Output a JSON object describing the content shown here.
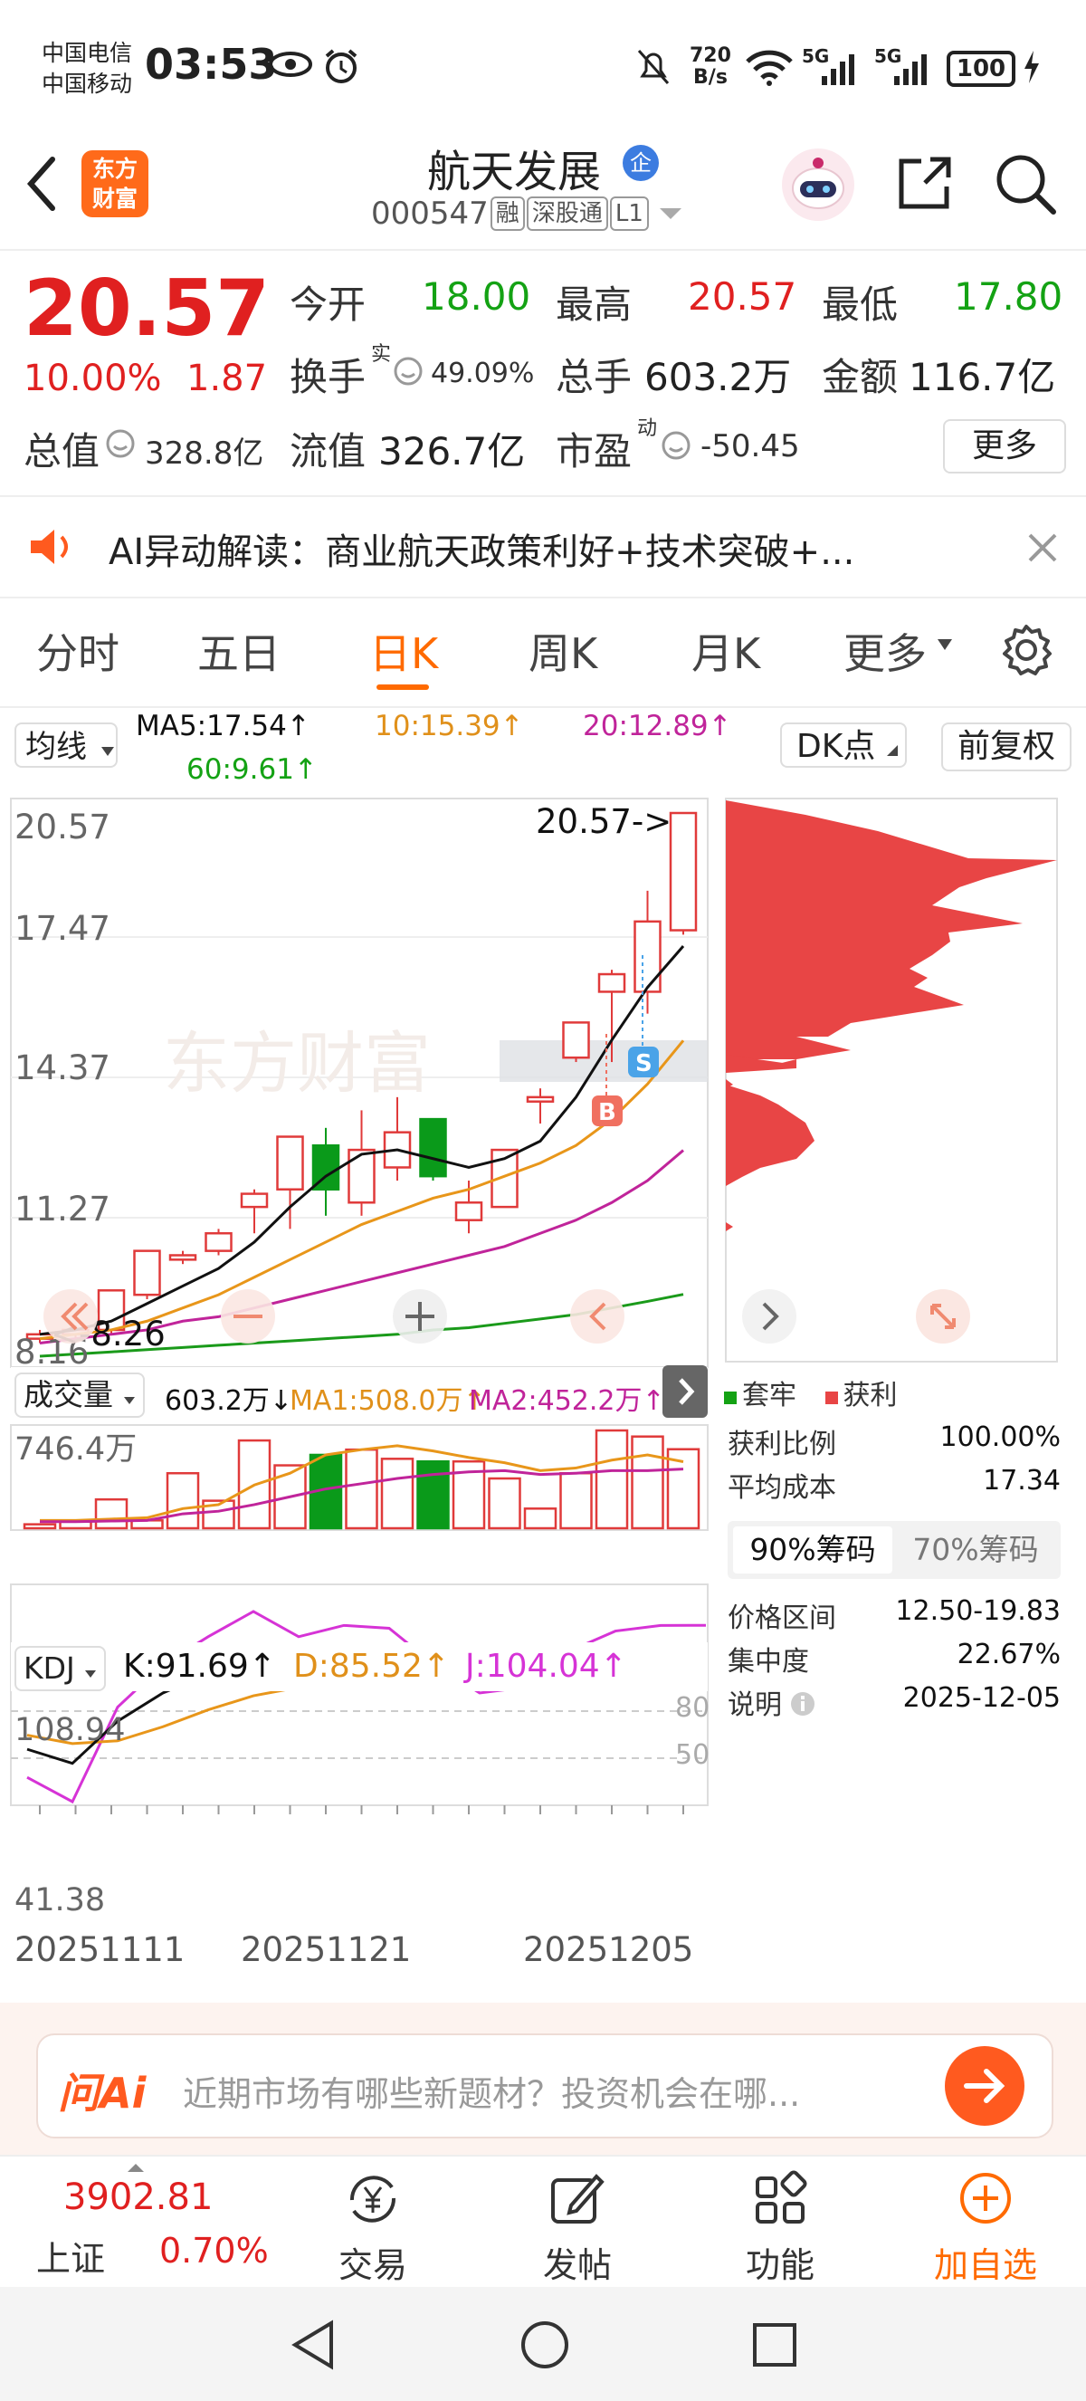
{
  "status_bar": {
    "carrier1": "中国电信",
    "carrier2": "中国移动",
    "time": "03:53",
    "net_speed_top": "720",
    "net_speed_bottom": "B/s",
    "signal1": "5G",
    "signal2": "5G",
    "battery": "100"
  },
  "header": {
    "logo_line1": "东方",
    "logo_line2": "财富",
    "title": "航天发展",
    "title_badge": "企",
    "code": "000547",
    "tags": [
      "融",
      "深股通",
      "L1"
    ]
  },
  "quote": {
    "price": "20.57",
    "change_pct": "10.00%",
    "change_amt": "1.87",
    "open_label": "今开",
    "open_value": "18.00",
    "high_label": "最高",
    "high_value": "20.57",
    "low_label": "最低",
    "low_value": "17.80",
    "turnover_label": "换手",
    "turnover_sup": "实",
    "turnover_value": "49.09%",
    "volume_label": "总手",
    "volume_value": "603.2万",
    "amount_label": "金额",
    "amount_value": "116.7亿",
    "mktcap_label": "总值",
    "mktcap_value": "328.8亿",
    "float_label": "流值",
    "float_value": "326.7亿",
    "pe_label": "市盈",
    "pe_sup": "动",
    "pe_value": "-50.45",
    "more_button": "更多"
  },
  "ai_banner": {
    "text": "AI异动解读：商业航天政策利好+技术突破+..."
  },
  "tabs": {
    "items": [
      "分时",
      "五日",
      "日K",
      "周K",
      "月K",
      "更多"
    ],
    "active_index": 2
  },
  "indicators": {
    "ma_selector": "均线",
    "ma5": "MA5:17.54↑",
    "ma10": "10:15.39↑",
    "ma20": "20:12.89↑",
    "ma60": "60:9.61↑",
    "dk_button": "DK点",
    "adjust_button": "前复权"
  },
  "main_chart": {
    "y_labels": [
      "20.57",
      "17.47",
      "14.37",
      "11.27",
      "8.16"
    ],
    "last_price_marker": "20.57->",
    "low_marker": "<-8.26",
    "watermark": "东方财富",
    "sell_badge": "S",
    "buy_badge": "B"
  },
  "chart_data": {
    "type": "candlestick",
    "candles": [
      {
        "o": 8.6,
        "c": 8.7,
        "h": 8.8,
        "l": 8.5,
        "up": true
      },
      {
        "o": 8.7,
        "c": 8.8,
        "h": 8.9,
        "l": 8.6,
        "up": true
      },
      {
        "o": 8.8,
        "c": 9.7,
        "h": 9.7,
        "l": 8.7,
        "up": true
      },
      {
        "o": 9.6,
        "c": 10.6,
        "h": 10.6,
        "l": 9.5,
        "up": true
      },
      {
        "o": 10.4,
        "c": 10.5,
        "h": 10.6,
        "l": 10.3,
        "up": true
      },
      {
        "o": 10.6,
        "c": 11.0,
        "h": 11.1,
        "l": 10.5,
        "up": true
      },
      {
        "o": 11.6,
        "c": 11.9,
        "h": 12.0,
        "l": 11.0,
        "up": true
      },
      {
        "o": 12.0,
        "c": 13.2,
        "h": 13.2,
        "l": 11.1,
        "up": true
      },
      {
        "o": 13.0,
        "c": 12.0,
        "h": 13.4,
        "l": 11.4,
        "up": false
      },
      {
        "o": 11.7,
        "c": 12.9,
        "h": 13.8,
        "l": 11.4,
        "up": true
      },
      {
        "o": 12.5,
        "c": 13.3,
        "h": 14.1,
        "l": 12.2,
        "up": true
      },
      {
        "o": 13.6,
        "c": 12.3,
        "h": 13.6,
        "l": 12.2,
        "up": false
      },
      {
        "o": 11.3,
        "c": 11.7,
        "h": 12.2,
        "l": 11.0,
        "up": true
      },
      {
        "o": 11.6,
        "c": 12.9,
        "h": 12.9,
        "l": 11.6,
        "up": true
      },
      {
        "o": 14.0,
        "c": 14.1,
        "h": 14.3,
        "l": 13.5,
        "up": true
      },
      {
        "o": 15.0,
        "c": 15.8,
        "h": 15.8,
        "l": 14.9,
        "up": true
      },
      {
        "o": 16.5,
        "c": 16.9,
        "h": 17.0,
        "l": 14.9,
        "up": true
      },
      {
        "o": 16.5,
        "c": 18.1,
        "h": 18.8,
        "l": 16.0,
        "up": true
      },
      {
        "o": 17.9,
        "c": 20.57,
        "h": 20.57,
        "l": 17.8,
        "up": true
      }
    ],
    "ma5": [
      8.7,
      8.8,
      9.0,
      9.4,
      9.8,
      10.2,
      10.8,
      11.6,
      12.3,
      12.8,
      12.9,
      12.7,
      12.5,
      12.7,
      13.1,
      14.1,
      15.4,
      16.6,
      17.54
    ],
    "ma10": [
      8.6,
      8.7,
      8.8,
      9.0,
      9.3,
      9.6,
      10.0,
      10.4,
      10.8,
      11.2,
      11.5,
      11.8,
      12.0,
      12.3,
      12.6,
      13.0,
      13.6,
      14.4,
      15.39
    ],
    "ma20": [
      8.5,
      8.6,
      8.7,
      8.8,
      9.0,
      9.1,
      9.3,
      9.5,
      9.7,
      9.9,
      10.1,
      10.3,
      10.5,
      10.7,
      11.0,
      11.3,
      11.7,
      12.2,
      12.89
    ],
    "ma60": [
      8.2,
      8.25,
      8.3,
      8.35,
      8.4,
      8.45,
      8.5,
      8.55,
      8.6,
      8.65,
      8.7,
      8.8,
      8.85,
      8.95,
      9.05,
      9.15,
      9.3,
      9.45,
      9.61
    ],
    "volume_wan": [
      30,
      50,
      220,
      60,
      420,
      210,
      670,
      480,
      560,
      600,
      530,
      510,
      510,
      380,
      150,
      420,
      746.4,
      700,
      603.2
    ],
    "volume_ma1": [
      60,
      60,
      70,
      80,
      150,
      180,
      330,
      420,
      560,
      600,
      630,
      590,
      540,
      500,
      440,
      460,
      520,
      560,
      508.0
    ],
    "volume_ma2": [
      50,
      50,
      55,
      60,
      110,
      130,
      180,
      240,
      300,
      340,
      380,
      410,
      430,
      440,
      410,
      420,
      440,
      440,
      452.2
    ],
    "kdj_k": [
      60,
      55,
      70,
      80,
      87,
      92,
      90,
      93,
      93,
      88,
      85,
      84,
      84,
      88,
      91,
      91.69
    ],
    "kdj_d": [
      65,
      62,
      63,
      68,
      74,
      79,
      82,
      84,
      84,
      84,
      84,
      84,
      83,
      84,
      85,
      85.52
    ],
    "kdj_j": [
      50,
      41.38,
      75,
      90,
      100,
      108.94,
      100,
      104,
      103,
      90,
      80,
      82,
      95,
      102,
      104,
      104.04
    ]
  },
  "volume_panel": {
    "selector": "成交量",
    "vol": "603.2万↓",
    "ma1": "MA1:508.0万↑",
    "ma2": "MA2:452.2万↑",
    "y_label": "746.4万"
  },
  "kdj_panel": {
    "selector": "KDJ",
    "k": "K:91.69↑",
    "d": "D:85.52↑",
    "j": "J:104.04↑",
    "y_top": "108.94",
    "y_bottom": "41.38",
    "level_80": "80",
    "level_50": "50"
  },
  "x_labels": [
    "20251111",
    "20251121",
    "20251205"
  ],
  "chip_panel": {
    "legend_trapped": "套牢",
    "legend_profit": "获利",
    "rows": [
      {
        "label": "获利比例",
        "value": "100.00%"
      },
      {
        "label": "平均成本",
        "value": "17.34"
      }
    ],
    "tab_90": "90%筹码",
    "tab_70": "70%筹码",
    "rows2": [
      {
        "label": "价格区间",
        "value": "12.50-19.83"
      },
      {
        "label": "集中度",
        "value": "22.67%"
      },
      {
        "label": "说明",
        "value": "2025-12-05"
      }
    ]
  },
  "ai_search": {
    "logo": "问Ai",
    "placeholder": "近期市场有哪些新题材？投资机会在哪..."
  },
  "bottom_nav": {
    "index_value": "3902.81",
    "index_name": "上证",
    "index_change": "0.70%",
    "items": [
      "交易",
      "发帖",
      "功能",
      "加自选"
    ]
  },
  "colors": {
    "up": "#e03a3a",
    "down": "#0a9a1a",
    "ma5": "#111111",
    "ma10": "#e8961a",
    "ma20": "#c0249a",
    "ma60": "#1a9a1a",
    "accent": "#ff6a00"
  }
}
